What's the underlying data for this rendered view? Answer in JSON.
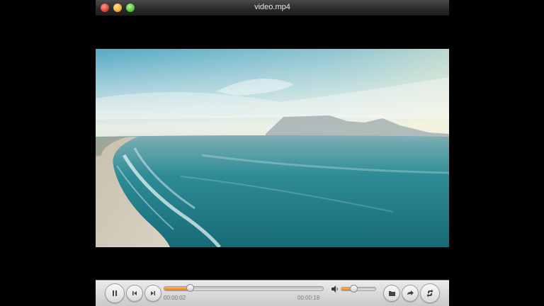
{
  "window": {
    "title": "video.mp4"
  },
  "playback": {
    "elapsed": "00:00:02",
    "duration": "00:00:18",
    "progress": 0.16,
    "volume": 0.35,
    "state": "playing"
  },
  "icons": {
    "play_pause": "pause-icon",
    "previous": "skip-previous-icon",
    "next": "skip-next-icon",
    "volume": "speaker-icon",
    "open": "folder-icon",
    "share": "share-icon",
    "loop": "loop-icon"
  },
  "colors": {
    "accent": "#f07a12",
    "titlebar": "#2b2b2b",
    "control_bar": "#dcdcdc"
  }
}
